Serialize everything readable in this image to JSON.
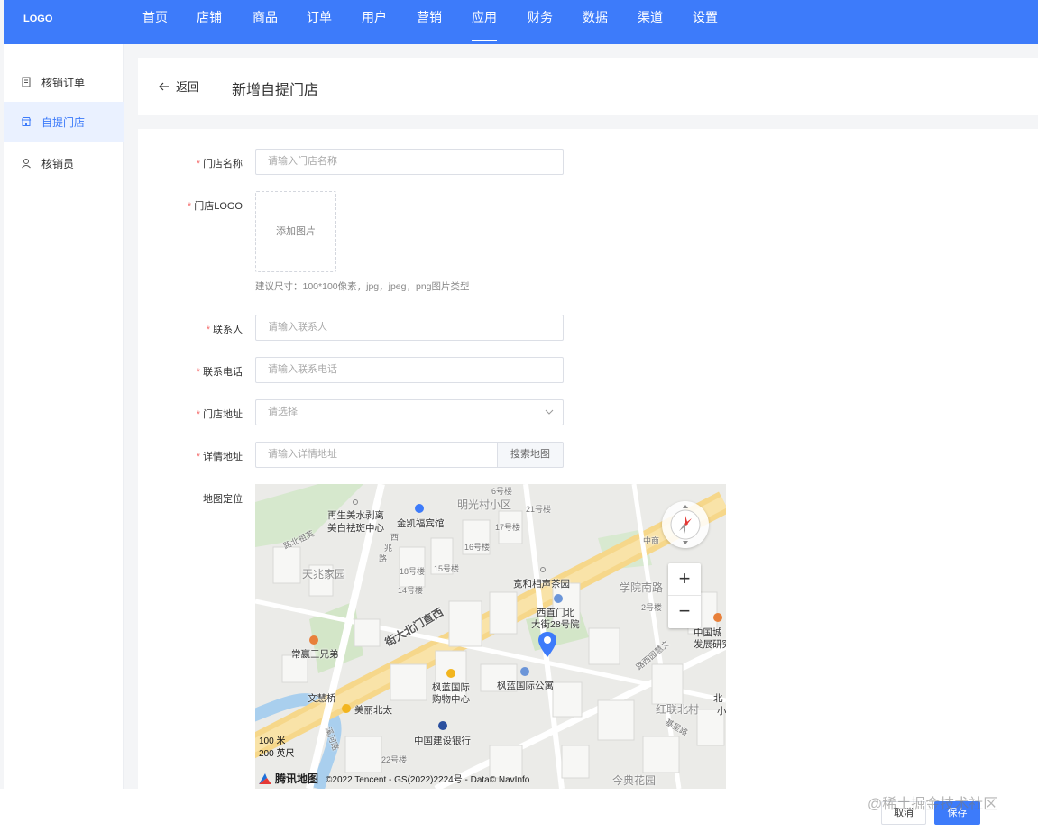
{
  "topbar": {
    "logo": "LOGO",
    "nav": [
      "首页",
      "店铺",
      "商品",
      "订单",
      "用户",
      "营销",
      "应用",
      "财务",
      "数据",
      "渠道",
      "设置"
    ],
    "active_index": 6
  },
  "sidebar": {
    "items": [
      {
        "label": "核销订单",
        "icon": "receipt-icon"
      },
      {
        "label": "自提门店",
        "icon": "store-icon"
      },
      {
        "label": "核销员",
        "icon": "user-icon"
      }
    ],
    "active_index": 1
  },
  "header": {
    "back_label": "返回",
    "title": "新增自提门店"
  },
  "form": {
    "store_name": {
      "label": "门店名称",
      "placeholder": "请输入门店名称"
    },
    "logo": {
      "label": "门店LOGO",
      "upload_text": "添加图片",
      "hint": "建议尺寸：100*100像素，jpg，jpeg，png图片类型"
    },
    "contact": {
      "label": "联系人",
      "placeholder": "请输入联系人"
    },
    "phone": {
      "label": "联系电话",
      "placeholder": "请输入联系电话"
    },
    "region": {
      "label": "门店地址",
      "placeholder": "请选择"
    },
    "address": {
      "label": "详情地址",
      "placeholder": "请输入详情地址",
      "search_label": "搜索地图"
    },
    "map": {
      "label": "地图定位",
      "places": {
        "p1": "明光村小区",
        "p2": "6号楼",
        "p3": "21号楼",
        "p4": "17号楼",
        "p5": "16号楼",
        "p6": "15号楼",
        "p7": "18号楼",
        "p8": "14号楼",
        "p9": "再生美水剥离",
        "p10": "美白祛斑中心",
        "p11": "金凯福宾馆",
        "p12": "路北祖芙",
        "p13": "西",
        "p14": "兆",
        "p15": "路",
        "p16": "天兆家园",
        "p17": "宽和相声茶园",
        "p18": "学院南路",
        "p19": "西直门北",
        "p20": "大街28号院",
        "p21": "中商",
        "p22": "2号楼",
        "p23": "中国城",
        "p24": "发展研究",
        "p25": "街大北门直西",
        "p26": "常嬴三兄弟",
        "p27": "路西园慧文",
        "p28": "枫蓝国际",
        "p29": "购物中心",
        "p30": "枫蓝国际公寓",
        "p31": "文慧桥",
        "p32": "美丽北太",
        "p33": "红联北村",
        "p34": "北",
        "p35": "小",
        "p36": "中国建设银行",
        "p37": "22号楼",
        "p38": "今典花园",
        "p39": "基星路",
        "p40": "溪河路"
      },
      "scale_metric": "100 米",
      "scale_imperial": "200 英尺",
      "brand": "腾讯地图",
      "copyright": "©2022 Tencent - GS(2022)2224号 - Data© NavInfo"
    }
  },
  "footer": {
    "cancel_label": "取消",
    "save_label": "保存",
    "watermark": "@稀土掘金技术社区"
  },
  "colors": {
    "primary": "#3d7bfa",
    "required": "#f56c6c",
    "sidebar_active_bg": "#eaf1ff"
  }
}
